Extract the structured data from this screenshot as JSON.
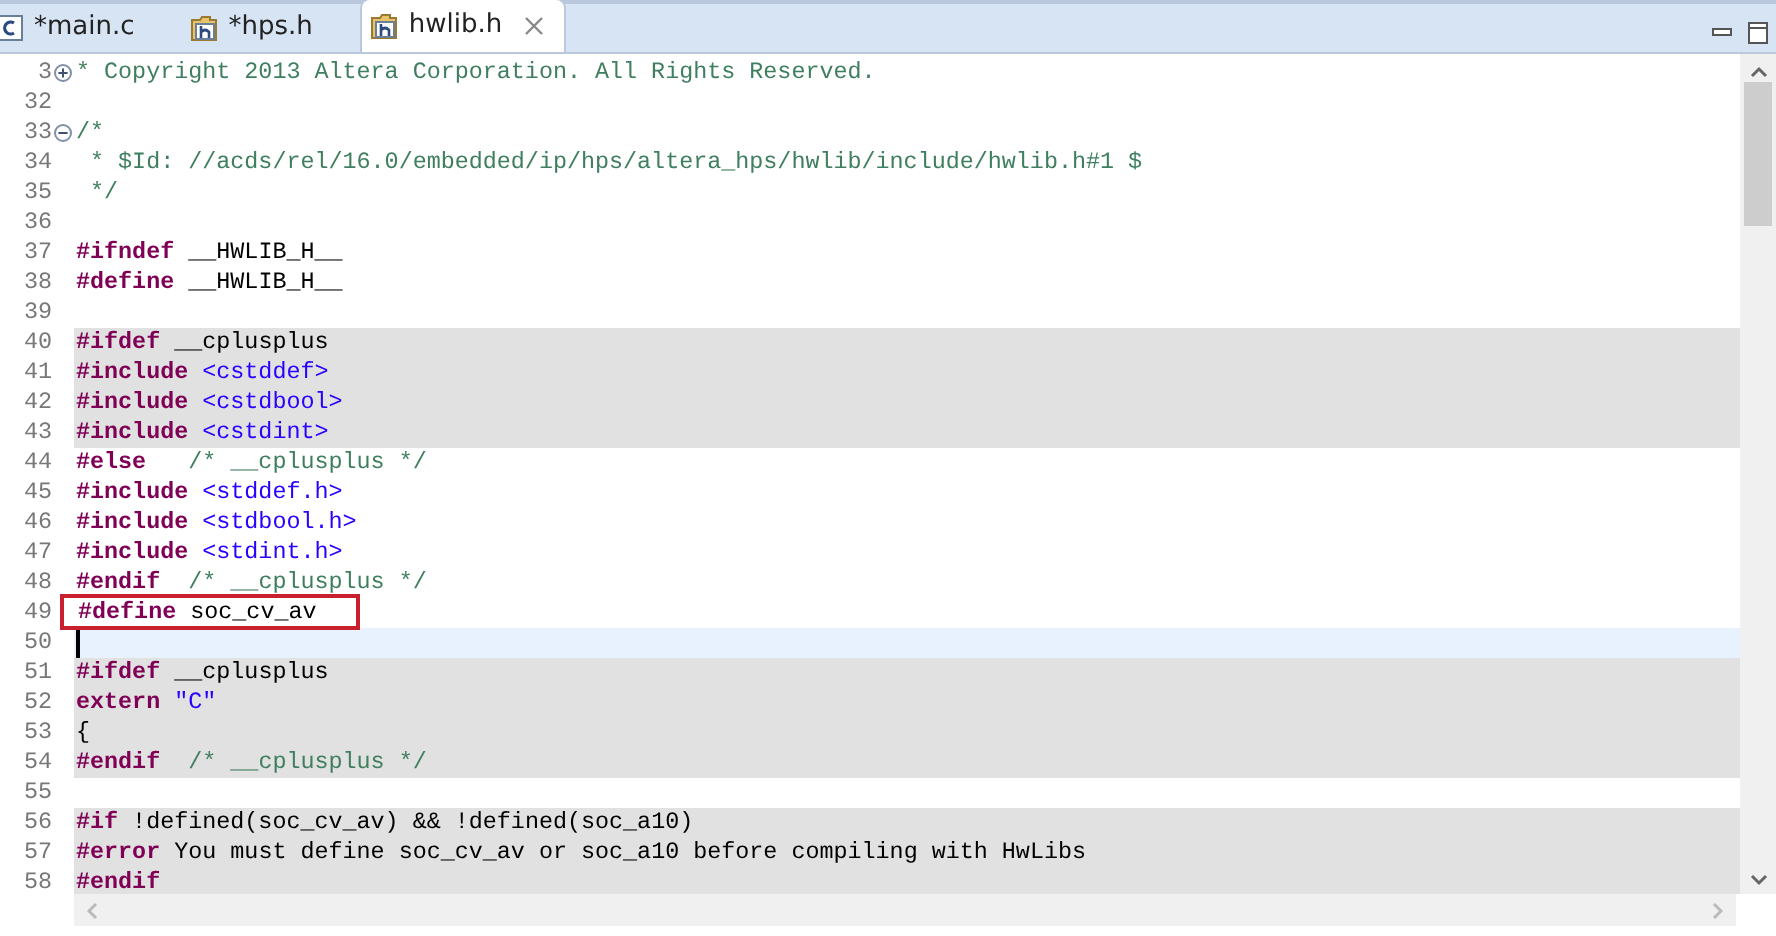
{
  "tabs": [
    {
      "label": "*main.c",
      "kind": "source",
      "selected": false
    },
    {
      "label": "*hps.h",
      "kind": "header",
      "selected": false
    },
    {
      "label": "hwlib.h",
      "kind": "header",
      "selected": true
    }
  ],
  "editor": {
    "lines": [
      {
        "number": "3",
        "folded": true,
        "inactive": false,
        "segments": [
          {
            "kind": "comment",
            "text": "* Copyright 2013 Altera Corporation. All Rights Reserved."
          }
        ]
      },
      {
        "number": "32"
      },
      {
        "number": "33",
        "folded": false,
        "inactive": false,
        "segments": [
          {
            "kind": "comment",
            "text": "/*"
          }
        ]
      },
      {
        "number": "34",
        "inactive": false,
        "segments": [
          {
            "kind": "comment",
            "text": " * $Id: //acds/rel/16.0/embedded/ip/hps/altera_hps/hwlib/include/hwlib.h#1 $"
          }
        ]
      },
      {
        "number": "35",
        "inactive": false,
        "segments": [
          {
            "kind": "comment",
            "text": " */"
          }
        ]
      },
      {
        "number": "36"
      },
      {
        "number": "37",
        "inactive": false,
        "segments": [
          {
            "kind": "keyword",
            "text": "#ifndef"
          },
          {
            "kind": "plain",
            "text": " __HWLIB_H__"
          }
        ]
      },
      {
        "number": "38",
        "inactive": false,
        "segments": [
          {
            "kind": "keyword",
            "text": "#define"
          },
          {
            "kind": "plain",
            "text": " __HWLIB_H__"
          }
        ]
      },
      {
        "number": "39"
      },
      {
        "number": "40",
        "inactive": true,
        "segments": [
          {
            "kind": "keyword",
            "text": "#ifdef"
          },
          {
            "kind": "plain",
            "text": " __cplusplus"
          }
        ]
      },
      {
        "number": "41",
        "inactive": true,
        "segments": [
          {
            "kind": "keyword",
            "text": "#include"
          },
          {
            "kind": "include",
            "text": " <cstddef>"
          }
        ]
      },
      {
        "number": "42",
        "inactive": true,
        "segments": [
          {
            "kind": "keyword",
            "text": "#include"
          },
          {
            "kind": "include",
            "text": " <cstdbool>"
          }
        ]
      },
      {
        "number": "43",
        "inactive": true,
        "segments": [
          {
            "kind": "keyword",
            "text": "#include"
          },
          {
            "kind": "include",
            "text": " <cstdint>"
          }
        ]
      },
      {
        "number": "44",
        "inactive": false,
        "segments": [
          {
            "kind": "keyword",
            "text": "#else"
          },
          {
            "kind": "comment",
            "text": "   /* __cplusplus */"
          }
        ]
      },
      {
        "number": "45",
        "inactive": false,
        "segments": [
          {
            "kind": "keyword",
            "text": "#include"
          },
          {
            "kind": "include",
            "text": " <stddef.h>"
          }
        ]
      },
      {
        "number": "46",
        "inactive": false,
        "segments": [
          {
            "kind": "keyword",
            "text": "#include"
          },
          {
            "kind": "include",
            "text": " <stdbool.h>"
          }
        ]
      },
      {
        "number": "47",
        "inactive": false,
        "segments": [
          {
            "kind": "keyword",
            "text": "#include"
          },
          {
            "kind": "include",
            "text": " <stdint.h>"
          }
        ]
      },
      {
        "number": "48",
        "inactive": false,
        "segments": [
          {
            "kind": "keyword",
            "text": "#endif"
          },
          {
            "kind": "comment",
            "text": "  /* __cplusplus */"
          }
        ]
      },
      {
        "number": "49",
        "inactive": false,
        "highlighted": true,
        "segments": [
          {
            "kind": "keyword",
            "text": "#define"
          },
          {
            "kind": "plain",
            "text": " soc_cv_av"
          }
        ]
      },
      {
        "number": "50",
        "current": true
      },
      {
        "number": "51",
        "inactive": true,
        "segments": [
          {
            "kind": "keyword",
            "text": "#ifdef"
          },
          {
            "kind": "plain",
            "text": " __cplusplus"
          }
        ]
      },
      {
        "number": "52",
        "inactive": true,
        "segments": [
          {
            "kind": "keyword",
            "text": "extern"
          },
          {
            "kind": "include",
            "text": " \"C\""
          }
        ]
      },
      {
        "number": "53",
        "inactive": true,
        "segments": [
          {
            "kind": "plain",
            "text": "{"
          }
        ]
      },
      {
        "number": "54",
        "inactive": true,
        "segments": [
          {
            "kind": "keyword",
            "text": "#endif"
          },
          {
            "kind": "comment",
            "text": "  /* __cplusplus */"
          }
        ]
      },
      {
        "number": "55"
      },
      {
        "number": "56",
        "inactive": true,
        "segments": [
          {
            "kind": "keyword",
            "text": "#if"
          },
          {
            "kind": "plain",
            "text": " !defined(soc_cv_av) && !defined(soc_a10)"
          }
        ]
      },
      {
        "number": "57",
        "inactive": true,
        "segments": [
          {
            "kind": "keyword",
            "text": "#error"
          },
          {
            "kind": "plain",
            "text": " You must define soc_cv_av or soc_a10 before compiling with HwLibs"
          }
        ]
      },
      {
        "number": "58",
        "inactive": true,
        "segments": [
          {
            "kind": "keyword",
            "text": "#endif"
          }
        ]
      }
    ]
  }
}
